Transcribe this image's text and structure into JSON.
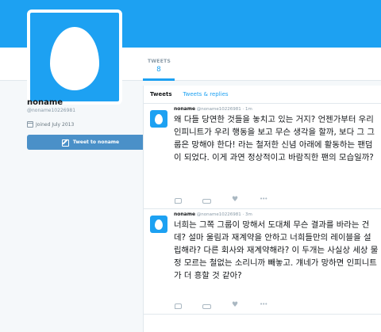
{
  "profile": {
    "name": "noname",
    "handle": "@noname10226981",
    "joined": "Joined July 2013",
    "tweet_to_label": "Tweet to noname"
  },
  "stats": {
    "tweets_label": "TWEETS",
    "tweets_value": "8"
  },
  "tabs": [
    {
      "label": "Tweets"
    },
    {
      "label": "Tweets & replies"
    }
  ],
  "tweets": [
    {
      "name": "noname",
      "handle": "@noname10226981 · 1m",
      "text": "왜 다들 당연한 것들을 놓치고 있는 거지? 언젠가부터 우리 인피니트가 우리 행동을 보고 무슨 생각을 할까, 보다 그 그룹은 망해야 한다! 라는 철저한 신념 아래에 활동하는 팬덤이 되었다. 이게 과연 정상적이고 바람직한 팬의 모습일까?"
    },
    {
      "name": "noname",
      "handle": "@noname10226981 · 3m",
      "text": "너희는 그쪽 그룹이 망해서 도대체 무슨 결과를 바라는 건데? 설마 울림과 재계약을 안하고 너희들만의 레이블을 설립해라? 다른 회사와 재계약해라? 이 두개는 사실상 세상 물정 모르는 철없는 소리니까 빼놓고. 걔네가 망하면 인피니트가 더 흥할 것 같아?"
    }
  ],
  "colors": {
    "brand": "#1da1f2",
    "button": "#4a90c8"
  }
}
